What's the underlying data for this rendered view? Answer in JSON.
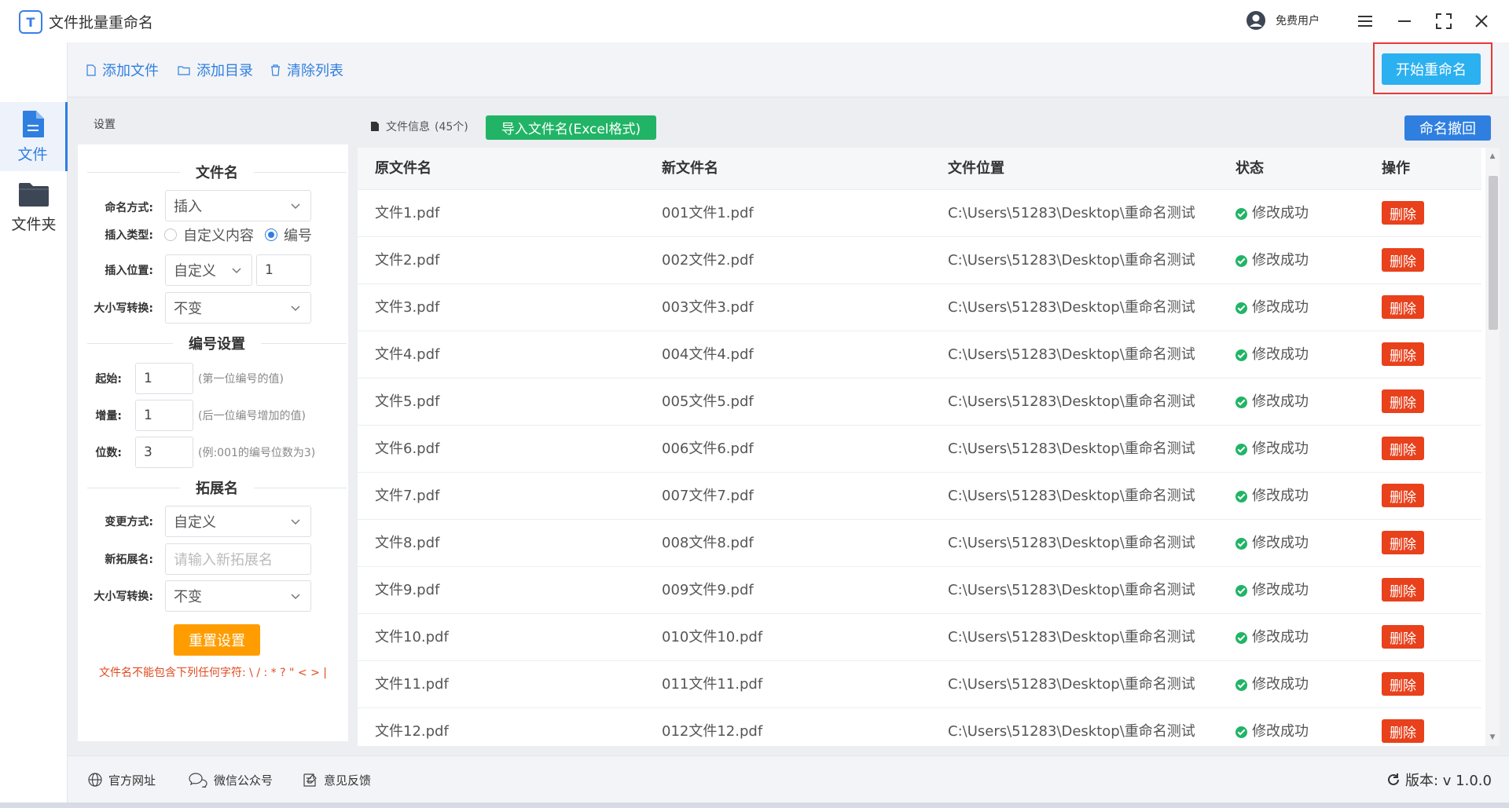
{
  "app": {
    "title": "文件批量重命名",
    "logo_letter": "T"
  },
  "user": {
    "name": "免费用户"
  },
  "toolbar": {
    "add_file": "添加文件",
    "add_dir": "添加目录",
    "clear_list": "清除列表",
    "start": "开始重命名"
  },
  "nav": [
    {
      "label": "文件",
      "icon": "file-icon",
      "active": true
    },
    {
      "label": "文件夹",
      "icon": "folder-icon",
      "active": false
    }
  ],
  "settings": {
    "header": "设置",
    "filename_section": "文件名",
    "naming_mode_label": "命名方式:",
    "naming_mode_value": "插入",
    "insert_type_label": "插入类型:",
    "insert_type_options": [
      "自定义内容",
      "编号"
    ],
    "insert_type_selected": "编号",
    "insert_pos_label": "插入位置:",
    "insert_pos_value": "自定义",
    "insert_pos_number": "1",
    "case_label": "大小写转换:",
    "case_value": "不变",
    "numbering_section": "编号设置",
    "start_label": "起始:",
    "start_value": "1",
    "start_hint": "(第一位编号的值)",
    "step_label": "增量:",
    "step_value": "1",
    "step_hint": "(后一位编号增加的值)",
    "digits_label": "位数:",
    "digits_value": "3",
    "digits_hint": "(例:001的编号位数为3)",
    "ext_section": "拓展名",
    "ext_mode_label": "变更方式:",
    "ext_mode_value": "自定义",
    "new_ext_label": "新拓展名:",
    "new_ext_placeholder": "请输入新拓展名",
    "ext_case_label": "大小写转换:",
    "ext_case_value": "不变",
    "reset": "重置设置",
    "warning": "文件名不能包含下列任何字符: \\ / : * ? \" < > |"
  },
  "files": {
    "info_label": "文件信息",
    "count_text": "(45个)",
    "import_btn": "导入文件名(Excel格式)",
    "undo_btn": "命名撤回",
    "columns": [
      "原文件名",
      "新文件名",
      "文件位置",
      "状态",
      "操作"
    ],
    "rows": [
      {
        "orig": "文件1.pdf",
        "new": "001文件1.pdf",
        "path": "C:\\Users\\51283\\Desktop\\重命名测试",
        "status": "修改成功",
        "action": "删除"
      },
      {
        "orig": "文件2.pdf",
        "new": "002文件2.pdf",
        "path": "C:\\Users\\51283\\Desktop\\重命名测试",
        "status": "修改成功",
        "action": "删除"
      },
      {
        "orig": "文件3.pdf",
        "new": "003文件3.pdf",
        "path": "C:\\Users\\51283\\Desktop\\重命名测试",
        "status": "修改成功",
        "action": "删除"
      },
      {
        "orig": "文件4.pdf",
        "new": "004文件4.pdf",
        "path": "C:\\Users\\51283\\Desktop\\重命名测试",
        "status": "修改成功",
        "action": "删除"
      },
      {
        "orig": "文件5.pdf",
        "new": "005文件5.pdf",
        "path": "C:\\Users\\51283\\Desktop\\重命名测试",
        "status": "修改成功",
        "action": "删除"
      },
      {
        "orig": "文件6.pdf",
        "new": "006文件6.pdf",
        "path": "C:\\Users\\51283\\Desktop\\重命名测试",
        "status": "修改成功",
        "action": "删除"
      },
      {
        "orig": "文件7.pdf",
        "new": "007文件7.pdf",
        "path": "C:\\Users\\51283\\Desktop\\重命名测试",
        "status": "修改成功",
        "action": "删除"
      },
      {
        "orig": "文件8.pdf",
        "new": "008文件8.pdf",
        "path": "C:\\Users\\51283\\Desktop\\重命名测试",
        "status": "修改成功",
        "action": "删除"
      },
      {
        "orig": "文件9.pdf",
        "new": "009文件9.pdf",
        "path": "C:\\Users\\51283\\Desktop\\重命名测试",
        "status": "修改成功",
        "action": "删除"
      },
      {
        "orig": "文件10.pdf",
        "new": "010文件10.pdf",
        "path": "C:\\Users\\51283\\Desktop\\重命名测试",
        "status": "修改成功",
        "action": "删除"
      },
      {
        "orig": "文件11.pdf",
        "new": "011文件11.pdf",
        "path": "C:\\Users\\51283\\Desktop\\重命名测试",
        "status": "修改成功",
        "action": "删除"
      },
      {
        "orig": "文件12.pdf",
        "new": "012文件12.pdf",
        "path": "C:\\Users\\51283\\Desktop\\重命名测试",
        "status": "修改成功",
        "action": "删除"
      }
    ]
  },
  "footer": {
    "website": "官方网址",
    "wechat": "微信公众号",
    "feedback": "意见反馈",
    "version": "版本: v 1.0.0"
  },
  "colors": {
    "accent": "#2f7fe0",
    "start": "#2bb0f0",
    "import": "#21b466",
    "delete": "#e8411c",
    "reset": "#ff9d00",
    "highlight": "#e53935"
  }
}
